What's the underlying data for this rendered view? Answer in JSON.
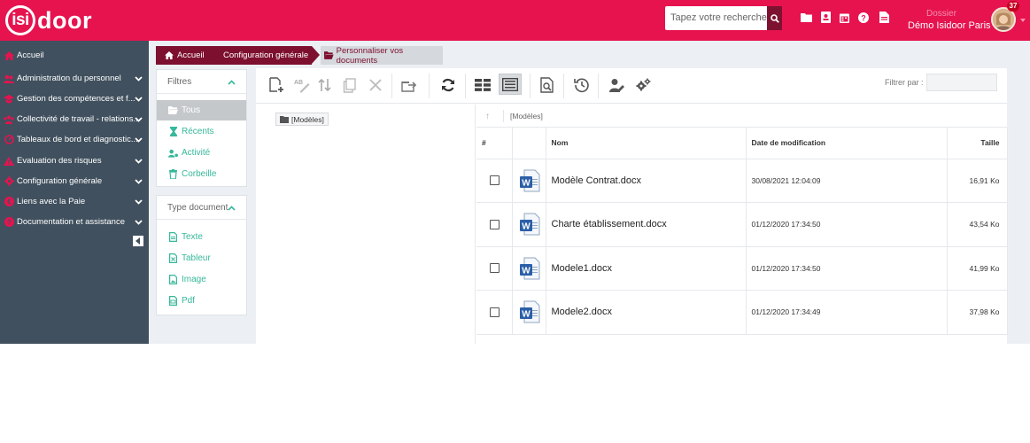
{
  "header": {
    "logo_prefix": "isi",
    "logo_suffix": "door",
    "search_placeholder": "Tapez votre recherche",
    "notification_count": "37",
    "user_role": "Dossier",
    "user_name": "Démo Isidoor Paris"
  },
  "sidebar": {
    "items": [
      {
        "label": "Accueil",
        "icon": "home-icon"
      },
      {
        "label": "Administration du personnel",
        "icon": "users-icon"
      },
      {
        "label": "Gestion des compétences et f...",
        "icon": "graduation-icon"
      },
      {
        "label": "Collectivité de travail - relations...",
        "icon": "group-icon"
      },
      {
        "label": "Tableaux de bord et diagnostic...",
        "icon": "dashboard-icon"
      },
      {
        "label": "Evaluation des risques",
        "icon": "warning-icon"
      },
      {
        "label": "Configuration générale",
        "icon": "gear-icon"
      },
      {
        "label": "Liens avec la Paie",
        "icon": "euro-icon"
      },
      {
        "label": "Documentation et assistance",
        "icon": "help-icon"
      }
    ]
  },
  "breadcrumb": {
    "items": [
      "Accueil",
      "Configuration générale",
      "Personnaliser vos documents"
    ]
  },
  "filters": {
    "title": "Filtres",
    "items": [
      "Tous",
      "Récents",
      "Activité",
      "Corbeille"
    ]
  },
  "doc_types": {
    "title": "Type document",
    "items": [
      "Texte",
      "Tableur",
      "Image",
      "Pdf"
    ]
  },
  "toolbar": {
    "filter_label": "Filtrer par :"
  },
  "tree": {
    "root": "[Modèles]"
  },
  "path": {
    "current": "[Modèles]"
  },
  "table": {
    "columns": [
      "#",
      "",
      "Nom",
      "Date de modification",
      "Taille"
    ],
    "rows": [
      {
        "name": "Modèle Contrat.docx",
        "date": "30/08/2021 12:04:09",
        "size": "16,91 Ko"
      },
      {
        "name": "Charte établissement.docx",
        "date": "01/12/2020 17:34:50",
        "size": "43,54 Ko"
      },
      {
        "name": "Modele1.docx",
        "date": "01/12/2020 17:34:50",
        "size": "41,99 Ko"
      },
      {
        "name": "Modele2.docx",
        "date": "01/12/2020 17:34:49",
        "size": "37,98 Ko"
      }
    ]
  },
  "colors": {
    "brand": "#e6134f",
    "brand_dark": "#7d0f2f",
    "sidebar": "#40505e",
    "accent_green": "#36b89a"
  }
}
